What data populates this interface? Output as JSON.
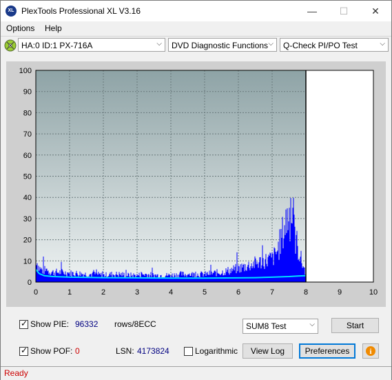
{
  "window": {
    "title": "PlexTools Professional XL V3.16",
    "icon_label": "XL",
    "minimize": "—",
    "maximize": "☐",
    "close": "✕"
  },
  "menu": {
    "options": "Options",
    "help": "Help"
  },
  "toolbar": {
    "drive": "HA:0 ID:1  PX-716A",
    "function": "DVD Diagnostic Functions",
    "test": "Q-Check PI/PO Test"
  },
  "chart_data": {
    "type": "area",
    "xlim": [
      0,
      10
    ],
    "ylim": [
      0,
      100
    ],
    "x_ticks": [
      "0",
      "1",
      "2",
      "3",
      "4",
      "5",
      "6",
      "7",
      "8",
      "9",
      "10"
    ],
    "y_ticks": [
      "0",
      "10",
      "20",
      "30",
      "40",
      "50",
      "60",
      "70",
      "80",
      "90",
      "100"
    ],
    "grid": true,
    "tested_end_x": 8,
    "series": [
      {
        "color": "#0000ff",
        "kind": "bars",
        "points": [
          [
            0.0,
            15
          ],
          [
            0.05,
            9
          ],
          [
            0.1,
            7
          ],
          [
            0.2,
            6
          ],
          [
            0.3,
            6
          ],
          [
            0.4,
            5.5
          ],
          [
            0.5,
            5
          ],
          [
            0.75,
            5
          ],
          [
            1.0,
            4.5
          ],
          [
            1.25,
            4.5
          ],
          [
            1.5,
            4
          ],
          [
            1.75,
            4
          ],
          [
            2.0,
            3.5
          ],
          [
            2.25,
            4
          ],
          [
            2.5,
            4
          ],
          [
            2.75,
            3.5
          ],
          [
            3.0,
            3.5
          ],
          [
            3.25,
            4
          ],
          [
            3.5,
            3.5
          ],
          [
            3.75,
            3.5
          ],
          [
            4.0,
            3.5
          ],
          [
            4.25,
            4
          ],
          [
            4.5,
            4
          ],
          [
            4.75,
            4
          ],
          [
            5.0,
            4
          ],
          [
            5.25,
            4.5
          ],
          [
            5.5,
            5
          ],
          [
            5.75,
            6
          ],
          [
            6.0,
            7
          ],
          [
            6.2,
            8
          ],
          [
            6.4,
            9
          ],
          [
            6.6,
            10
          ],
          [
            6.8,
            11
          ],
          [
            7.0,
            12
          ],
          [
            7.1,
            14
          ],
          [
            7.2,
            18
          ],
          [
            7.3,
            24
          ],
          [
            7.4,
            30
          ],
          [
            7.45,
            33
          ],
          [
            7.5,
            35
          ],
          [
            7.55,
            33
          ],
          [
            7.6,
            30
          ],
          [
            7.7,
            22
          ],
          [
            7.8,
            15
          ],
          [
            7.9,
            9
          ],
          [
            8.0,
            5
          ]
        ]
      },
      {
        "color": "#00e0ff",
        "kind": "line",
        "points": [
          [
            0.0,
            6
          ],
          [
            0.1,
            4
          ],
          [
            0.25,
            3
          ],
          [
            0.5,
            2.6
          ],
          [
            1.0,
            2.3
          ],
          [
            2.0,
            2.1
          ],
          [
            3.0,
            2.0
          ],
          [
            4.0,
            1.9
          ],
          [
            5.0,
            1.9
          ],
          [
            6.0,
            2.0
          ],
          [
            6.5,
            2.1
          ],
          [
            7.0,
            2.3
          ],
          [
            7.5,
            2.6
          ],
          [
            7.8,
            2.9
          ],
          [
            8.0,
            3.0
          ]
        ]
      }
    ]
  },
  "controls": {
    "show_pie_label": "Show PIE:",
    "pie_value": "96332",
    "pie_unit": "rows/8ECC",
    "show_pof_label": "Show POF:",
    "pof_value": "0",
    "lsn_label": "LSN:",
    "lsn_value": "4173824",
    "logarithmic_label": "Logarithmic",
    "sum_test": "SUM8 Test",
    "start": "Start",
    "view_log": "View Log",
    "preferences": "Preferences",
    "checked_mark": "✓",
    "info_icon": "i"
  },
  "status": {
    "text": "Ready"
  },
  "colors": {
    "plot_bg_top": "#8ea3a6",
    "plot_bg_bottom": "#e8eeee",
    "pie_bars": "#0000ff",
    "pif_avg": "#00e0ff",
    "status_text": "#cc0000"
  }
}
